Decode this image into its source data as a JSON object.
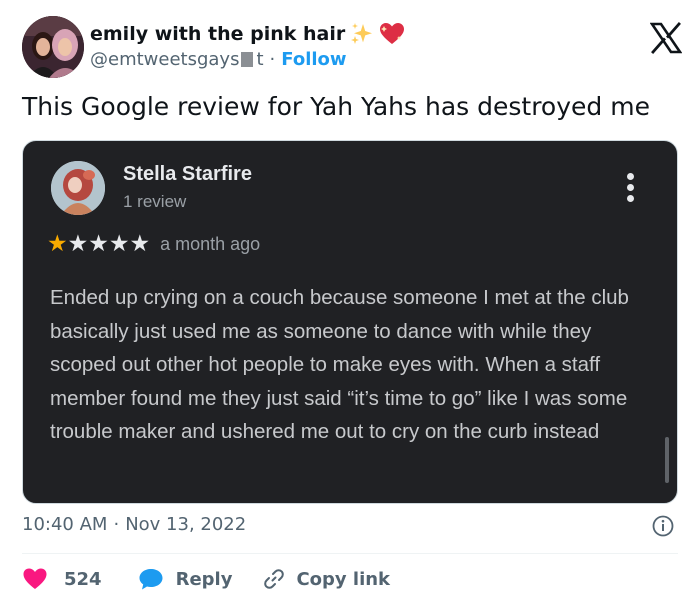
{
  "author": {
    "display_name": "emily with the pink hair",
    "handle_start": "@emtweetsgays",
    "handle_end": "t",
    "separator": "·",
    "follow_label": "Follow"
  },
  "tweet": {
    "text": "This Google review for Yah Yahs has destroyed me",
    "time": "10:40 AM",
    "meta_separator": "·",
    "date": "Nov 13, 2022"
  },
  "review": {
    "reviewer_name": "Stella Starfire",
    "review_count": "1 review",
    "rating": 1,
    "rating_max": 5,
    "date": "a month ago",
    "body": "Ended up crying on a couch because someone I met at the club basically just used me as someone to dance with while they scoped out other hot people to make eyes with. When a staff member found me they just said “it’s time to go” like I was some trouble maker and ushered me out to cry on the curb instead"
  },
  "actions": {
    "like_count": "524",
    "reply_label": "Reply",
    "copy_label": "Copy link"
  },
  "icons": {
    "header_emoji": [
      "sparkles-icon",
      "heart-icon"
    ],
    "logo": "x-logo-icon",
    "more": "kebab-menu-icon",
    "info": "info-icon",
    "like": "heart-icon",
    "reply": "speech-bubble-icon",
    "copy": "link-icon"
  },
  "colors": {
    "like": "#f91880",
    "reply": "#1d9bf0",
    "follow": "#1d9bf0",
    "star": "#f9ab00",
    "card_background": "#202124"
  }
}
